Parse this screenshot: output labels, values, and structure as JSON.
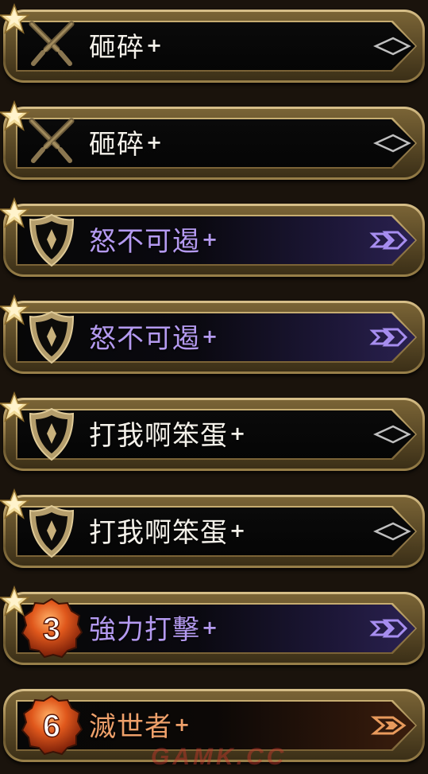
{
  "cards": [
    {
      "title": "砸碎",
      "plus": "+",
      "emblem": "crossed-swords-icon",
      "tier": "plain",
      "starred": true
    },
    {
      "title": "砸碎",
      "plus": "+",
      "emblem": "crossed-swords-icon",
      "tier": "plain",
      "starred": true
    },
    {
      "title": "怒不可遏",
      "plus": "+",
      "emblem": "shield-icon",
      "tier": "purple",
      "starred": true
    },
    {
      "title": "怒不可遏",
      "plus": "+",
      "emblem": "shield-icon",
      "tier": "purple",
      "starred": true
    },
    {
      "title": "打我啊笨蛋",
      "plus": "+",
      "emblem": "shield-icon",
      "tier": "plain",
      "starred": true
    },
    {
      "title": "打我啊笨蛋",
      "plus": "+",
      "emblem": "shield-icon",
      "tier": "plain",
      "starred": true
    },
    {
      "title": "強力打擊",
      "plus": "+",
      "emblem": "cost-gem-icon",
      "cost": "3",
      "tier": "purple",
      "starred": true
    },
    {
      "title": "滅世者",
      "plus": "+",
      "emblem": "cost-gem-icon",
      "cost": "6",
      "tier": "orange",
      "starred": false
    }
  ],
  "watermark": "GAMK.CC",
  "colors": {
    "gold": "#c8ae72",
    "purple_text": "#b49af0",
    "orange_text": "#eea06a",
    "white_text": "#f4f1ea",
    "gem": "#d9541e"
  }
}
